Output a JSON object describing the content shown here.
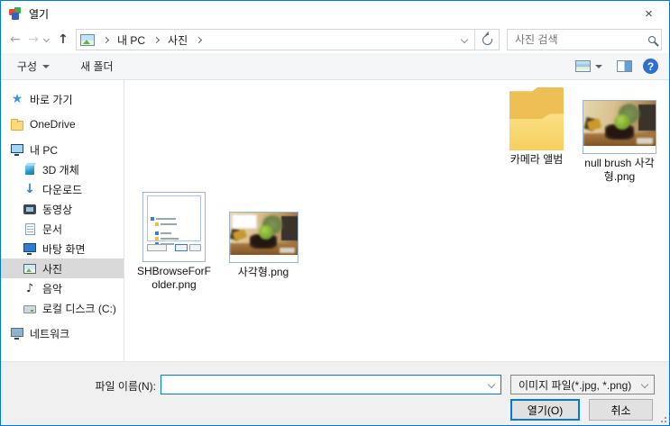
{
  "colors": {
    "accent": "#0078d7",
    "selection_bg": "#d9d9d9",
    "folder_yellow": "#f6cf5e",
    "help_blue": "#2f6fce"
  },
  "window": {
    "title": "열기",
    "close_glyph": "×"
  },
  "nav": {
    "back_glyph": "←",
    "forward_glyph": "→",
    "up_glyph": "↑",
    "breadcrumb": {
      "items": [
        "내 PC",
        "사진"
      ]
    },
    "search_placeholder": "사진 검색"
  },
  "toolbar": {
    "organize_label": "구성",
    "new_folder_label": "새 폴더",
    "help_glyph": "?"
  },
  "sidebar": {
    "items": [
      {
        "label": "바로 가기",
        "icon": "quick-access-star"
      },
      {
        "label": "OneDrive",
        "icon": "onedrive-folder"
      },
      {
        "label": "내 PC",
        "icon": "computer"
      },
      {
        "label": "3D 개체",
        "icon": "3d-cube"
      },
      {
        "label": "다운로드",
        "icon": "download-arrow"
      },
      {
        "label": "동영상",
        "icon": "video"
      },
      {
        "label": "문서",
        "icon": "document"
      },
      {
        "label": "바탕 화면",
        "icon": "desktop-monitor"
      },
      {
        "label": "사진",
        "icon": "pictures",
        "selected": true
      },
      {
        "label": "음악",
        "icon": "music-note"
      },
      {
        "label": "로컬 디스크 (C:)",
        "icon": "hard-drive"
      },
      {
        "label": "네트워크",
        "icon": "network-computer"
      }
    ],
    "download_glyph": "↓",
    "music_glyph": "♪",
    "star_glyph": "★"
  },
  "files": [
    {
      "name": "카메라 앨범",
      "kind": "folder"
    },
    {
      "name": "null brush 사각형.png",
      "kind": "image"
    },
    {
      "name": "SHBrowseForFolder.png",
      "kind": "image"
    },
    {
      "name": "사각형.png",
      "kind": "image"
    }
  ],
  "footer": {
    "filename_label": "파일 이름(N):",
    "filename_value": "",
    "filetype_value": "이미지 파일(*.jpg, *.png)",
    "open_label": "열기(O)",
    "cancel_label": "취소"
  }
}
